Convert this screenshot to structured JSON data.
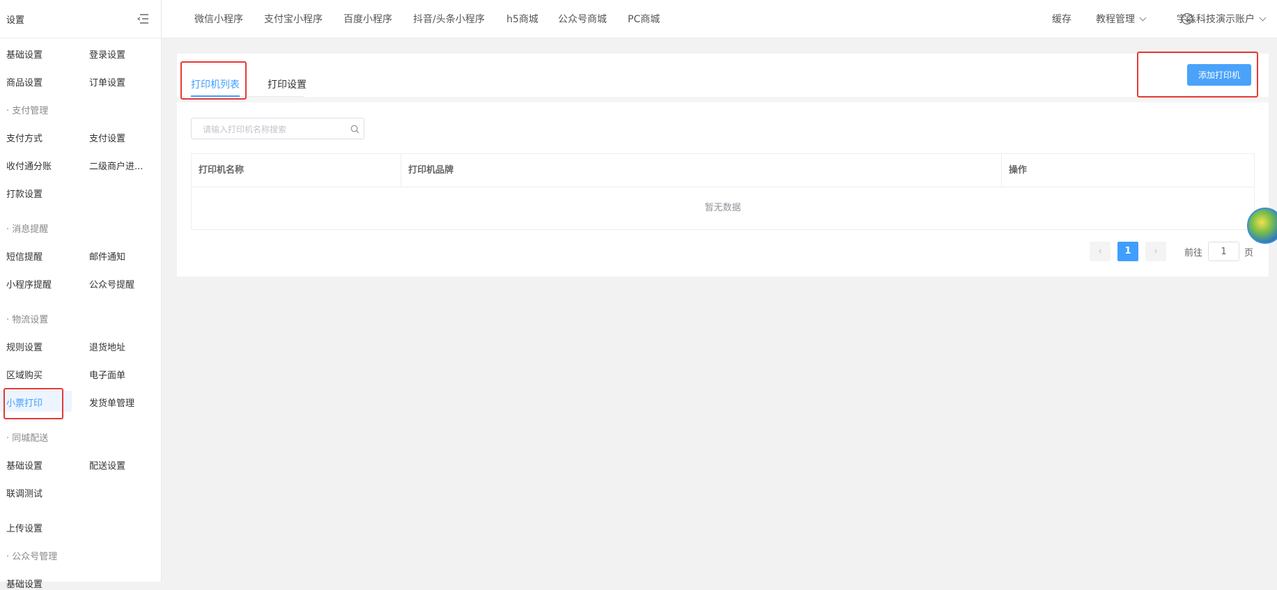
{
  "sidebar": {
    "title": "设置",
    "groups": {
      "pay": "· 支付管理",
      "msg": "· 消息提醒",
      "logistics": "· 物流设置",
      "city": "· 同城配送",
      "mp": "· 公众号管理"
    },
    "items": {
      "basic": "基础设置",
      "login": "登录设置",
      "goods": "商品设置",
      "order": "订单设置",
      "pay_method": "支付方式",
      "pay_setting": "支付设置",
      "split": "收付通分账",
      "sub_merchant": "二级商户进...",
      "payout": "打款设置",
      "sms": "短信提醒",
      "email": "邮件通知",
      "mini_remind": "小程序提醒",
      "mp_remind": "公众号提醒",
      "rule": "规则设置",
      "return_addr": "退货地址",
      "region_buy": "区域购买",
      "e_waybill": "电子面单",
      "receipt_print": "小票打印",
      "ship_doc": "发货单管理",
      "city_basic": "基础设置",
      "delivery": "配送设置",
      "joint_test": "联调测试",
      "upload": "上传设置",
      "mp_basic": "基础设置"
    },
    "active_item": "小票打印"
  },
  "topbar": {
    "nav": [
      "微信小程序",
      "支付宝小程序",
      "百度小程序",
      "抖音/头条小程序",
      "h5商城",
      "公众号商城",
      "PC商城"
    ],
    "cache": "缓存",
    "tutorial": "教程管理",
    "account": "宇淼科技演示账户"
  },
  "main": {
    "tabs": [
      "打印机列表",
      "打印设置"
    ],
    "active_tab": "打印机列表",
    "add_button": "添加打印机",
    "search_placeholder": "请输入打印机名称搜索",
    "table": {
      "columns": [
        "打印机名称",
        "打印机品牌",
        "操作"
      ],
      "empty_text": "暂无数据"
    },
    "pagination": {
      "current_page": "1",
      "goto_prefix": "前往",
      "goto_value": "1",
      "goto_suffix": "页"
    }
  },
  "colors": {
    "accent": "#409eff",
    "highlight": "#e53935"
  }
}
